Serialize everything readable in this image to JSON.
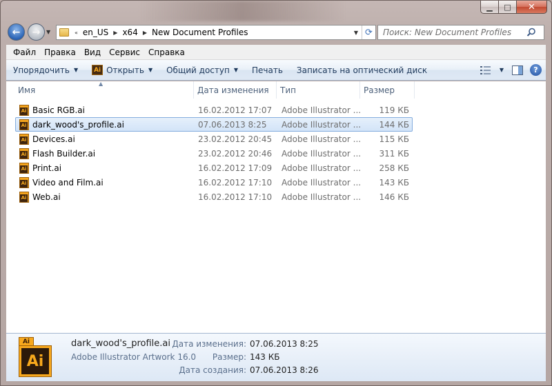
{
  "nav": {
    "breadcrumbs": [
      "en_US",
      "x64",
      "New Document Profiles"
    ],
    "search_placeholder": "Поиск: New Document Profiles"
  },
  "menu": [
    "Файл",
    "Правка",
    "Вид",
    "Сервис",
    "Справка"
  ],
  "toolbar": {
    "organize": "Упорядочить",
    "open": "Открыть",
    "share": "Общий доступ",
    "print": "Печать",
    "burn": "Записать на оптический диск"
  },
  "columns": {
    "name": "Имя",
    "date": "Дата изменения",
    "type": "Тип",
    "size": "Размер"
  },
  "files": [
    {
      "name": "Basic RGB.ai",
      "date": "16.02.2012 17:07",
      "type": "Adobe Illustrator ...",
      "size": "119 КБ",
      "selected": false
    },
    {
      "name": "dark_wood's_profile.ai",
      "date": "07.06.2013 8:25",
      "type": "Adobe Illustrator ...",
      "size": "144 КБ",
      "selected": true
    },
    {
      "name": "Devices.ai",
      "date": "23.02.2012 20:45",
      "type": "Adobe Illustrator ...",
      "size": "115 КБ",
      "selected": false
    },
    {
      "name": "Flash Builder.ai",
      "date": "23.02.2012 20:46",
      "type": "Adobe Illustrator ...",
      "size": "311 КБ",
      "selected": false
    },
    {
      "name": "Print.ai",
      "date": "16.02.2012 17:09",
      "type": "Adobe Illustrator ...",
      "size": "258 КБ",
      "selected": false
    },
    {
      "name": "Video and Film.ai",
      "date": "16.02.2012 17:10",
      "type": "Adobe Illustrator ...",
      "size": "143 КБ",
      "selected": false
    },
    {
      "name": "Web.ai",
      "date": "16.02.2012 17:10",
      "type": "Adobe Illustrator ...",
      "size": "146 КБ",
      "selected": false
    }
  ],
  "details": {
    "icon_label": "Ai",
    "file_name": "dark_wood's_profile.ai",
    "file_type": "Adobe Illustrator Artwork 16.0",
    "modified_label": "Дата изменения:",
    "modified_value": "07.06.2013 8:25",
    "size_label": "Размер:",
    "size_value": "143 КБ",
    "created_label": "Дата создания:",
    "created_value": "07.06.2013 8:26"
  }
}
